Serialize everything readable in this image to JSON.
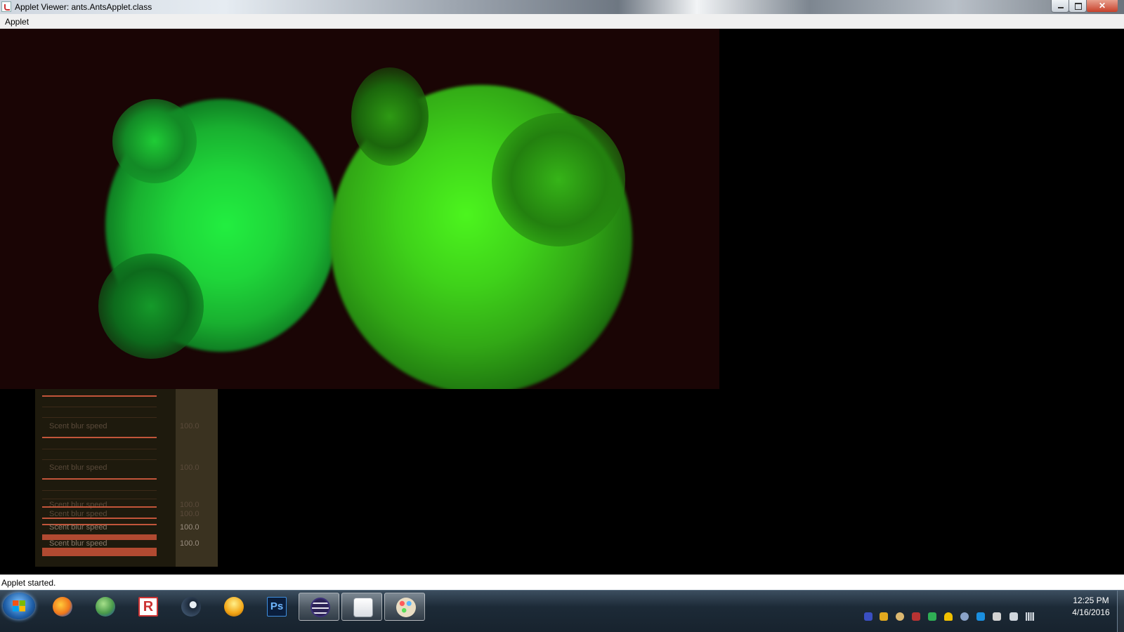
{
  "window": {
    "title": "Applet Viewer: ants.AntsApplet.class",
    "buttons": {
      "minimize": "minimize",
      "maximize": "maximize",
      "close": "close"
    }
  },
  "menu": {
    "items": [
      "Applet"
    ]
  },
  "panel": {
    "rows": [
      {
        "label": "Scent blur speed",
        "value": "100.0"
      },
      {
        "label": "Scent blur speed",
        "value": "100.0"
      },
      {
        "label": "Scent blur speed",
        "value": "100.0"
      },
      {
        "label": "Scent blur speed",
        "value": "100.0"
      },
      {
        "label": "Scent blur speed",
        "value": "100.0"
      },
      {
        "label": "Scent blur speed",
        "value": "100.0"
      }
    ]
  },
  "status": {
    "text": "Applet started."
  },
  "taskbar": {
    "apps": [
      "firefox-icon",
      "globe-icon",
      "roblox-icon",
      "steam-icon",
      "fl-studio-icon",
      "photoshop-icon",
      "eclipse-icon",
      "java-icon",
      "paint-icon"
    ],
    "photoshop_label": "Ps",
    "roblox_label": "R",
    "clock": {
      "time": "12:25 PM",
      "date": "4/16/2016"
    }
  },
  "colors": {
    "sim_background": "#1a0505",
    "colony_left": "#22e83a",
    "colony_right": "#49f01e",
    "slider_red": "#b14a31"
  }
}
